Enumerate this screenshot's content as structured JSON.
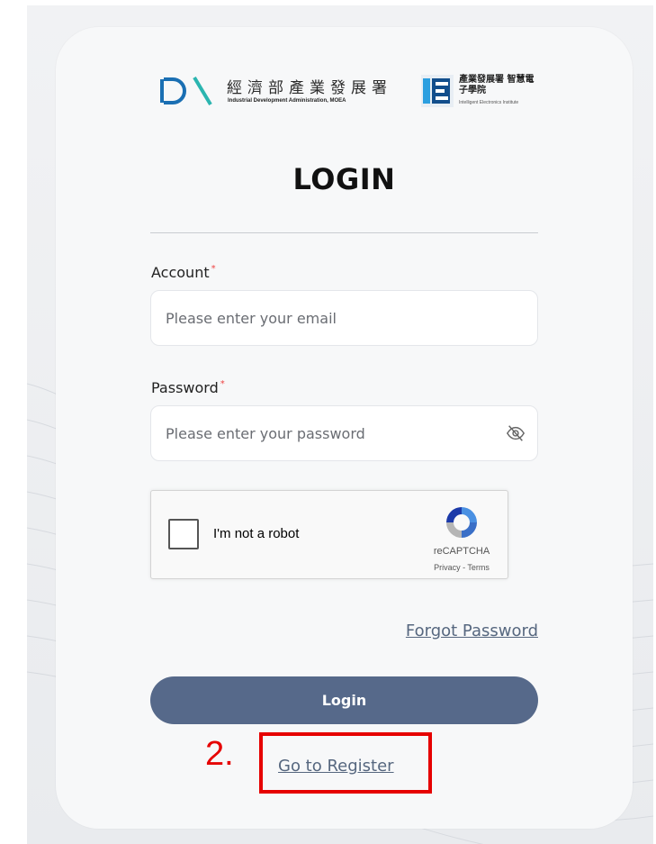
{
  "header": {
    "org1_cn": "經濟部產業發展署",
    "org1_en": "Industrial Development Administration, MOEA",
    "org2_cn": "產業發展署 智慧電子學院",
    "org2_en": "Intelligent Electronics Institute"
  },
  "title": "LOGIN",
  "account": {
    "label": "Account",
    "required": "*",
    "placeholder": "Please enter your email",
    "value": ""
  },
  "password": {
    "label": "Password",
    "required": "*",
    "placeholder": "Please enter your password",
    "value": ""
  },
  "captcha": {
    "text": "I'm not a robot",
    "brand": "reCAPTCHA",
    "links": "Privacy - Terms"
  },
  "forgot_password": "Forgot Password",
  "login_button": "Login",
  "register_link": "Go to Register",
  "annotation": {
    "step": "2."
  },
  "colors": {
    "button": "#56698a",
    "link": "#56677f",
    "highlight": "#e60000",
    "ida_blue": "#1a6fb3",
    "ida_teal": "#2bb5b0"
  }
}
